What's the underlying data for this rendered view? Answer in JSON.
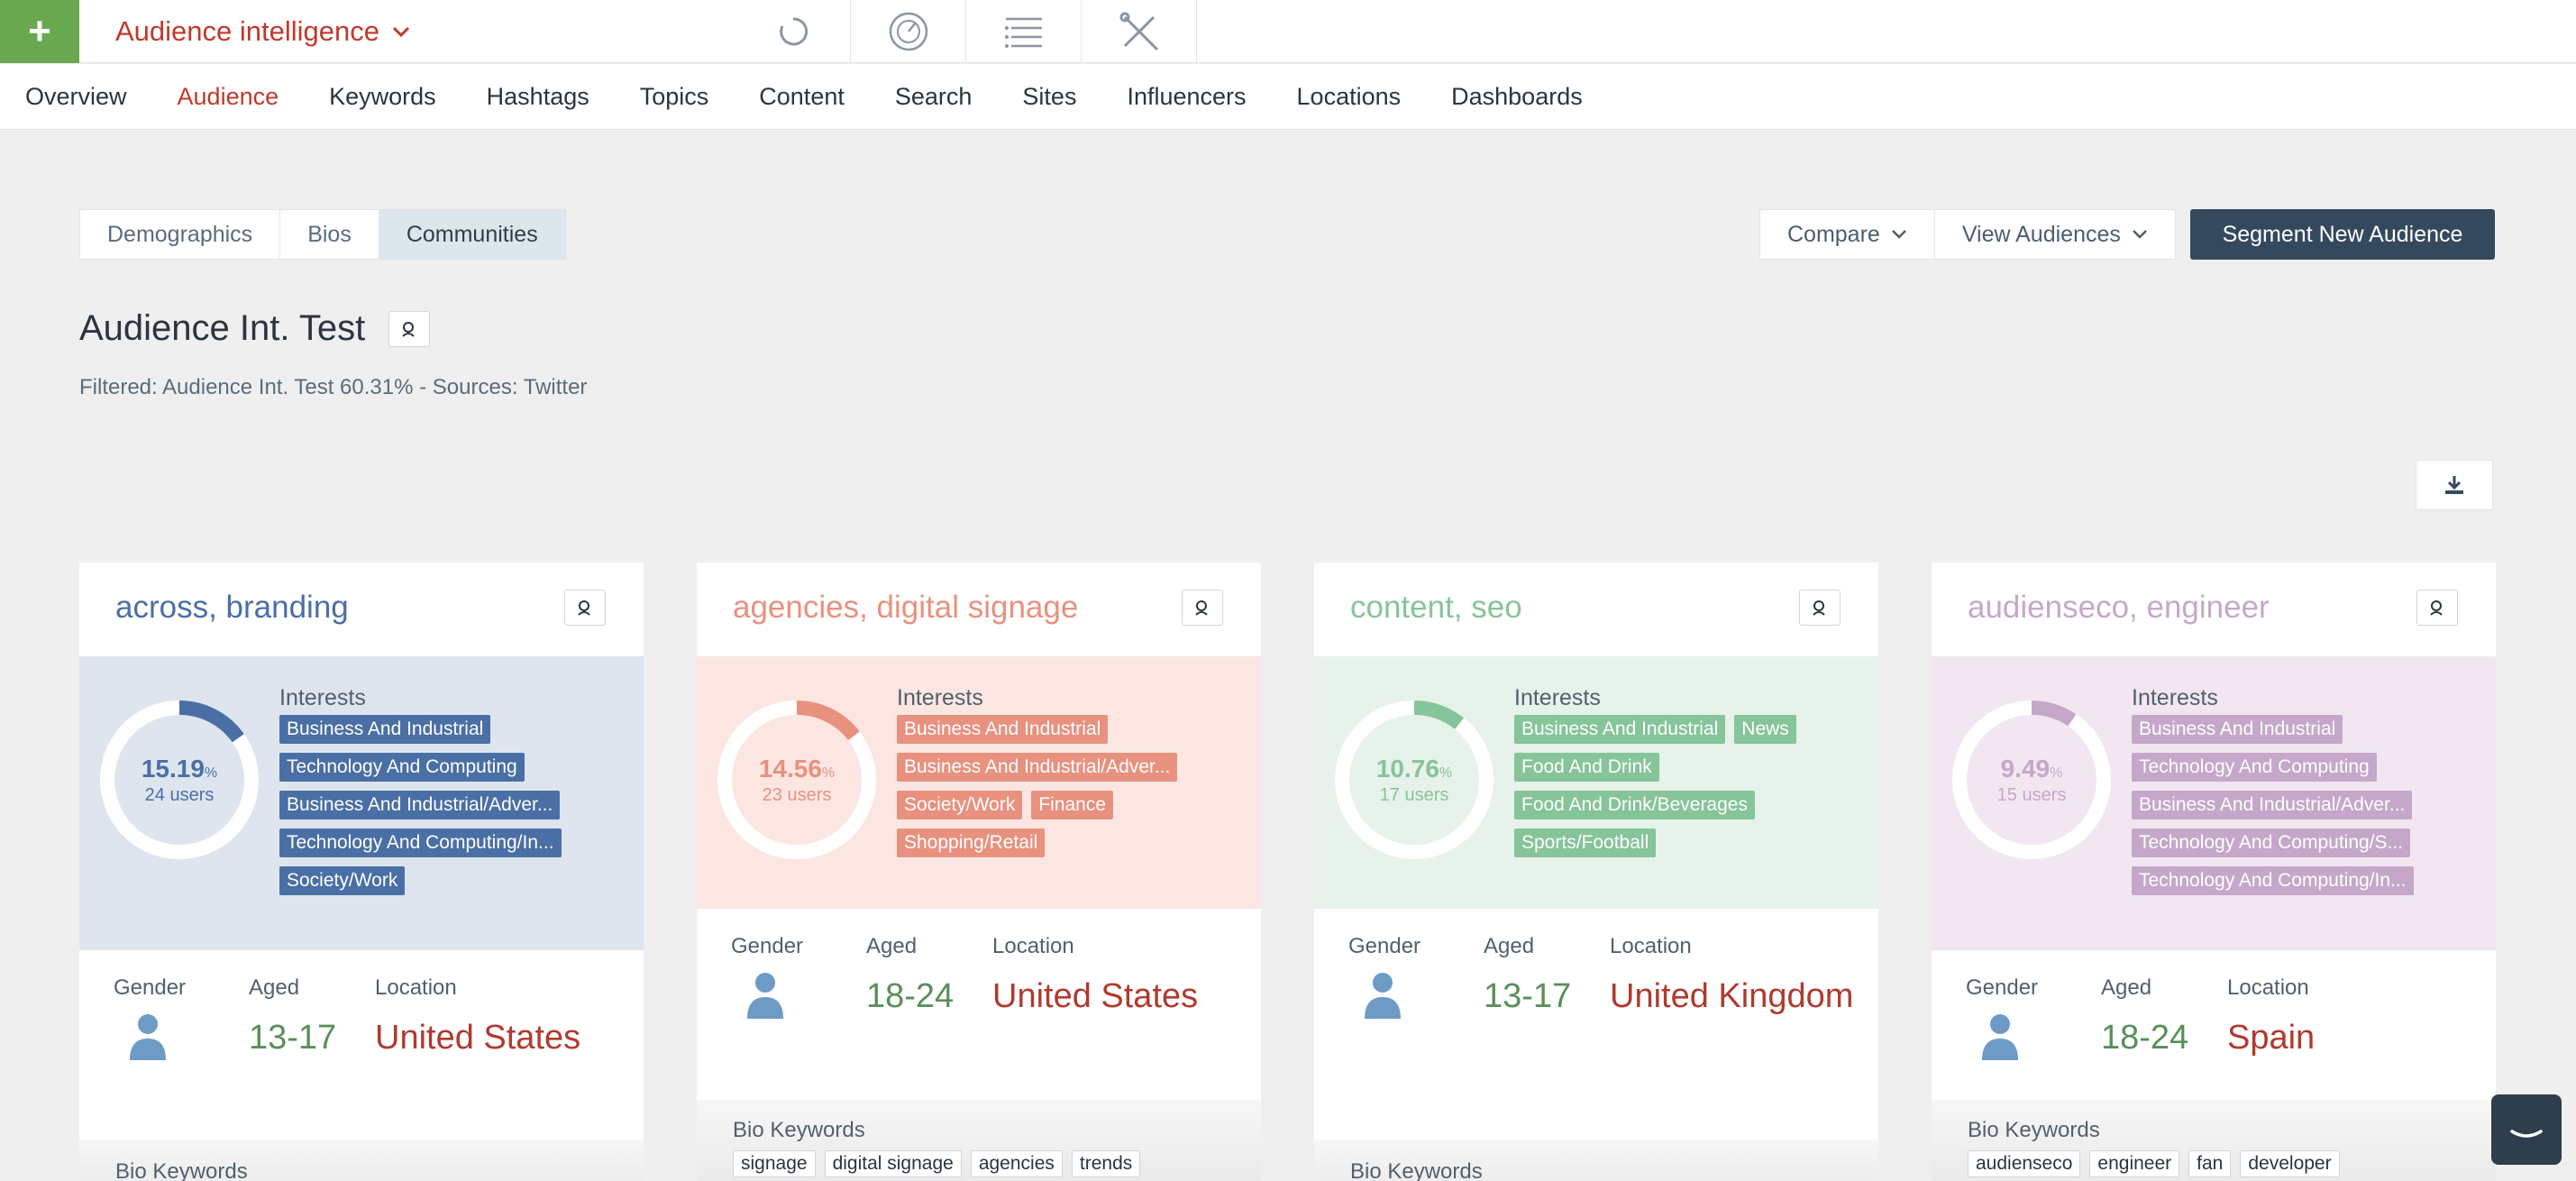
{
  "topbar": {
    "plus_label": "+",
    "app_title": "Audience intelligence",
    "tools": [
      "spinner-icon",
      "dashboard-gauge-icon",
      "list-icon",
      "tools-icon"
    ]
  },
  "nav": {
    "items": [
      "Overview",
      "Audience",
      "Keywords",
      "Hashtags",
      "Topics",
      "Content",
      "Search",
      "Sites",
      "Influencers",
      "Locations",
      "Dashboards"
    ],
    "active": "Audience"
  },
  "subtabs": [
    "Demographics",
    "Bios",
    "Communities"
  ],
  "subtabs_active": "Communities",
  "actions": {
    "compare": "Compare",
    "view_audiences": "View Audiences",
    "segment": "Segment New Audience"
  },
  "audience": {
    "title": "Audience Int. Test",
    "filter": "Filtered: Audience Int. Test 60.31% - Sources: Twitter"
  },
  "cards": [
    {
      "title": "across, branding",
      "color": "#4a6fa5",
      "bg": "#dfe5ef",
      "percent": "15.19",
      "percent_fraction": 0.1519,
      "users": "24 users",
      "interests_label": "Interests",
      "interests": [
        "Business And Industrial",
        "Technology And Computing",
        "Business And Industrial/Adver...",
        "Technology And Computing/In...",
        "Society/Work"
      ],
      "gender_label": "Gender",
      "aged_label": "Aged",
      "aged": "13-17",
      "location_label": "Location",
      "location": "United States",
      "bio_label": "Bio Keywords",
      "bio_keywords": []
    },
    {
      "title": "agencies, digital signage",
      "color": "#e8917f",
      "bg": "#fbe6e2",
      "percent": "14.56",
      "percent_fraction": 0.1456,
      "users": "23 users",
      "interests_label": "Interests",
      "interests": [
        "Business And Industrial",
        "Business And Industrial/Adver...",
        "Society/Work",
        "Finance",
        "Shopping/Retail"
      ],
      "gender_label": "Gender",
      "aged_label": "Aged",
      "aged": "18-24",
      "location_label": "Location",
      "location": "United States",
      "bio_label": "Bio Keywords",
      "bio_keywords": [
        "signage",
        "digital signage",
        "agencies",
        "trends"
      ]
    },
    {
      "title": "content, seo",
      "color": "#86c49a",
      "bg": "#e6f2ea",
      "percent": "10.76",
      "percent_fraction": 0.1076,
      "users": "17 users",
      "interests_label": "Interests",
      "interests": [
        "Business And Industrial",
        "News",
        "Food And Drink",
        "Food And Drink/Beverages",
        "Sports/Football"
      ],
      "gender_label": "Gender",
      "aged_label": "Aged",
      "aged": "13-17",
      "location_label": "Location",
      "location": "United Kingdom",
      "bio_label": "Bio Keywords",
      "bio_keywords": []
    },
    {
      "title": "audienseco, engineer",
      "color": "#c5a8c9",
      "bg": "#f2e7f1",
      "percent": "9.49",
      "percent_fraction": 0.0949,
      "users": "15 users",
      "interests_label": "Interests",
      "interests": [
        "Business And Industrial",
        "Technology And Computing",
        "Business And Industrial/Adver...",
        "Technology And Computing/S...",
        "Technology And Computing/In..."
      ],
      "gender_label": "Gender",
      "aged_label": "Aged",
      "aged": "18-24",
      "location_label": "Location",
      "location": "Spain",
      "bio_label": "Bio Keywords",
      "bio_keywords": [
        "audienseco",
        "engineer",
        "fan",
        "developer"
      ]
    }
  ]
}
